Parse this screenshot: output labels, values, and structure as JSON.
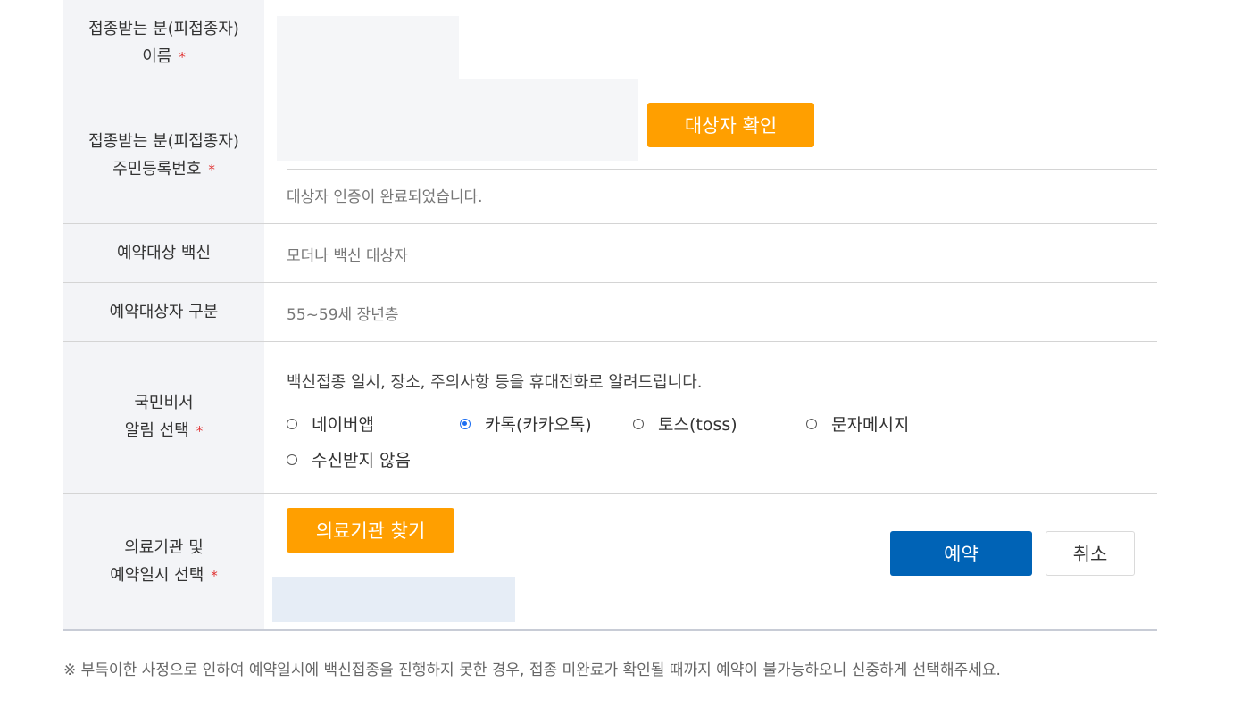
{
  "rows": {
    "name": {
      "label_line1": "접종받는 분(피접종자)",
      "label_line2": "이름",
      "required": "*"
    },
    "rrn": {
      "label_line1": "접종받는 분(피접종자)",
      "label_line2": "주민등록번호",
      "required": "*",
      "verify_button": "대상자 확인",
      "status_text": "대상자 인증이 완료되었습니다."
    },
    "vaccine": {
      "label": "예약대상 백신",
      "value": "모더나 백신 대상자"
    },
    "category": {
      "label": "예약대상자 구분",
      "value": "55~59세 장년층"
    },
    "notify": {
      "label_line1": "국민비서",
      "label_line2": "알림 선택",
      "required": "*",
      "description": "백신접종 일시, 장소, 주의사항 등을 휴대전화로 알려드립니다.",
      "options": [
        {
          "label": "네이버앱",
          "checked": false
        },
        {
          "label": "카톡(카카오톡)",
          "checked": true
        },
        {
          "label": "토스(toss)",
          "checked": false
        },
        {
          "label": "문자메시지",
          "checked": false
        },
        {
          "label": "수신받지 않음",
          "checked": false
        }
      ]
    },
    "hospital": {
      "label_line1": "의료기관 및",
      "label_line2": "예약일시 선택",
      "required": "*",
      "find_button": "의료기관 찾기"
    }
  },
  "actions": {
    "reserve": "예약",
    "cancel": "취소"
  },
  "notice": "※ 부득이한 사정으로 인하여 예약일시에 백신접종을 진행하지 못한 경우, 접종 미완료가 확인될 때까지 예약이 불가능하오니 신중하게 선택해주세요.",
  "colors": {
    "accent_orange": "#ff9f00",
    "primary_blue": "#0063b6",
    "radio_selected": "#1c6ef2",
    "required_star": "#e03030",
    "label_bg": "#f3f4f7"
  }
}
